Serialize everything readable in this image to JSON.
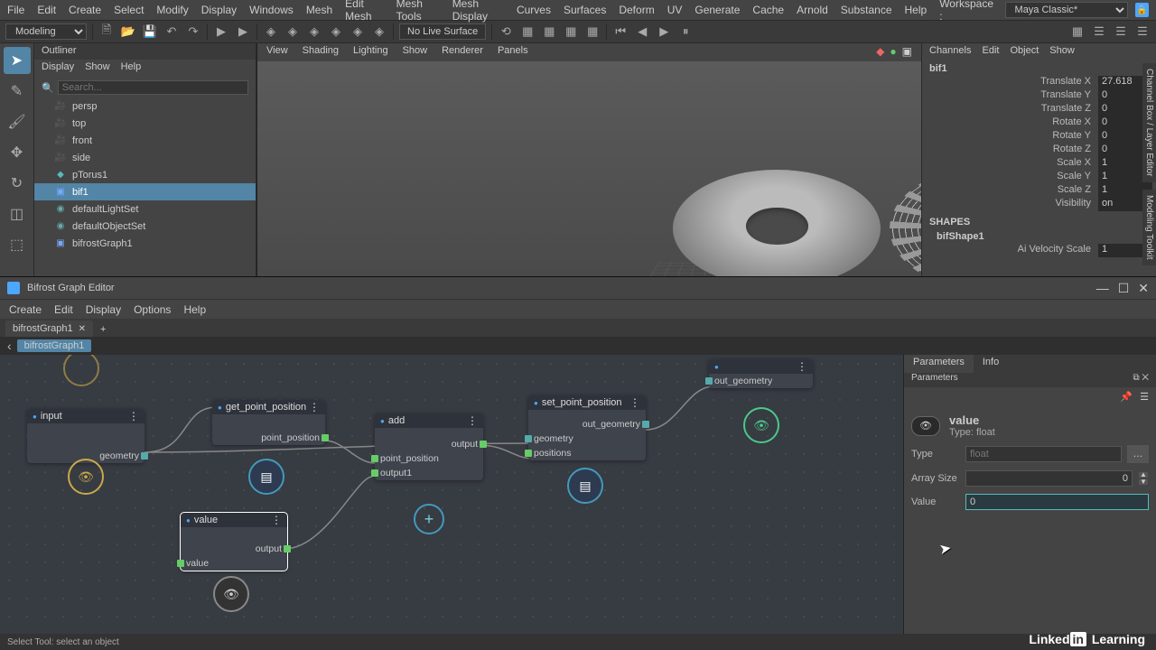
{
  "menubar": [
    "File",
    "Edit",
    "Create",
    "Select",
    "Modify",
    "Display",
    "Windows",
    "Mesh",
    "Edit Mesh",
    "Mesh Tools",
    "Mesh Display",
    "Curves",
    "Surfaces",
    "Deform",
    "UV",
    "Generate",
    "Cache",
    "Arnold",
    "Substance",
    "Help"
  ],
  "workspace_label": "Workspace :",
  "workspace_value": "Maya Classic*",
  "shelf_mode": "Modeling",
  "shelf_live": "No Live Surface",
  "outliner": {
    "title": "Outliner",
    "menu": [
      "Display",
      "Show",
      "Help"
    ],
    "search_placeholder": "Search...",
    "items": [
      {
        "label": "persp",
        "icon": "cam"
      },
      {
        "label": "top",
        "icon": "cam"
      },
      {
        "label": "front",
        "icon": "cam"
      },
      {
        "label": "side",
        "icon": "cam"
      },
      {
        "label": "pTorus1",
        "icon": "mesh"
      },
      {
        "label": "bif1",
        "icon": "bif",
        "selected": true
      },
      {
        "label": "defaultLightSet",
        "icon": "set"
      },
      {
        "label": "defaultObjectSet",
        "icon": "set"
      },
      {
        "label": "bifrostGraph1",
        "icon": "bif"
      }
    ]
  },
  "viewport_menu": [
    "View",
    "Shading",
    "Lighting",
    "Show",
    "Renderer",
    "Panels"
  ],
  "channelbox": {
    "menu": [
      "Channels",
      "Edit",
      "Object",
      "Show"
    ],
    "name": "bif1",
    "rows": [
      {
        "label": "Translate X",
        "val": "27.618"
      },
      {
        "label": "Translate Y",
        "val": "0"
      },
      {
        "label": "Translate Z",
        "val": "0"
      },
      {
        "label": "Rotate X",
        "val": "0"
      },
      {
        "label": "Rotate Y",
        "val": "0"
      },
      {
        "label": "Rotate Z",
        "val": "0"
      },
      {
        "label": "Scale X",
        "val": "1"
      },
      {
        "label": "Scale Y",
        "val": "1"
      },
      {
        "label": "Scale Z",
        "val": "1"
      },
      {
        "label": "Visibility",
        "val": "on"
      }
    ],
    "shapes_header": "SHAPES",
    "shape_name": "bifShape1",
    "extra_rows": [
      {
        "label": "Ai Velocity Scale",
        "val": "1"
      }
    ],
    "sidebar_label": "Channel Box / Layer Editor",
    "toolkit_label": "Modeling Toolkit"
  },
  "bifrost": {
    "title": "Bifrost Graph Editor",
    "menu": [
      "Create",
      "Edit",
      "Display",
      "Options",
      "Help"
    ],
    "tab": "bifrostGraph1",
    "crumb": "bifrostGraph1",
    "nodes": {
      "input": {
        "title": "input",
        "ports_out": [
          {
            "label": "geometry",
            "geo": true
          }
        ]
      },
      "getpp": {
        "title": "get_point_position",
        "ports_out": [
          {
            "label": "point_position"
          }
        ]
      },
      "value": {
        "title": "value",
        "ports_in": [
          {
            "label": "value"
          }
        ],
        "ports_out": [
          {
            "label": "output"
          }
        ]
      },
      "add": {
        "title": "add",
        "ports_in": [
          {
            "label": "point_position"
          },
          {
            "label": "output1"
          }
        ],
        "ports_out": [
          {
            "label": "output"
          }
        ]
      },
      "setpp": {
        "title": "set_point_position",
        "ports_in": [
          {
            "label": "geometry",
            "geo": true
          },
          {
            "label": "positions"
          }
        ],
        "ports_out": [
          {
            "label": "out_geometry",
            "geo": true
          }
        ]
      },
      "outgeo": {
        "title": "",
        "ports_in": [
          {
            "label": "out_geometry",
            "geo": true
          }
        ]
      }
    },
    "parameters": {
      "tab_params": "Parameters",
      "tab_info": "Info",
      "subheader": "Parameters",
      "node_name": "value",
      "node_type": "Type: float",
      "type_label": "Type",
      "type_value": "float",
      "array_label": "Array Size",
      "array_value": "0",
      "value_label": "Value",
      "value_value": "0"
    }
  },
  "statusbar": "Select Tool: select an object",
  "brand": {
    "box": "Linked",
    "in": "in",
    "rest": " Learning"
  }
}
